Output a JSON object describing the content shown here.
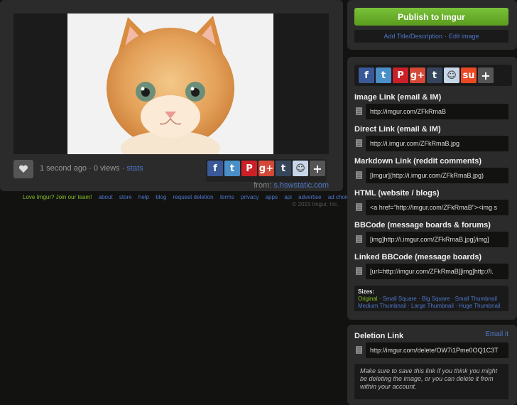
{
  "image": {
    "time_ago": "1 second ago",
    "views": "0 views",
    "stats_label": "stats",
    "from_label": "from:",
    "from_source": "s.hswstatic.com"
  },
  "footer": {
    "join": "Love Imgur? Join our team!",
    "links": [
      "about",
      "store",
      "help",
      "blog",
      "request deletion",
      "terms",
      "privacy",
      "apps",
      "api",
      "advertise",
      "ad choices"
    ],
    "copyright": "© 2015 Imgur, Inc."
  },
  "publish": {
    "button": "Publish to Imgur",
    "add_title": "Add Title/Description",
    "edit_image": "Edit image"
  },
  "links": [
    {
      "label": "Image Link (email & IM)",
      "value": "http://imgur.com/ZFkRmaB"
    },
    {
      "label": "Direct Link (email & IM)",
      "value": "http://i.imgur.com/ZFkRmaB.jpg"
    },
    {
      "label": "Markdown Link (reddit comments)",
      "value": "[Imgur](http://i.imgur.com/ZFkRmaB.jpg)"
    },
    {
      "label": "HTML (website / blogs)",
      "value": "<a href=\"http://imgur.com/ZFkRmaB\"><img s"
    },
    {
      "label": "BBCode (message boards & forums)",
      "value": "[img]http://i.imgur.com/ZFkRmaB.jpg[/img]"
    },
    {
      "label": "Linked BBCode (message boards)",
      "value": "[url=http://imgur.com/ZFkRmaB][img]http://i."
    }
  ],
  "sizes": {
    "title": "Sizes:",
    "original": "Original",
    "items": [
      "Small Square",
      "Big Square",
      "Small Thumbnail",
      "Medium Thumbnail",
      "Large Thumbnail",
      "Huge Thumbnail"
    ]
  },
  "deletion": {
    "label": "Deletion Link",
    "email_it": "Email it",
    "value": "http://imgur.com/delete/OW7i1Pme0OQ1C3T",
    "note": "Make sure to save this link if you think you might be deleting the image, or you can delete it from within your account."
  },
  "colors": {
    "accent_blue": "#4e76c9",
    "accent_green": "#85bf25",
    "panel": "#2b2b2b",
    "background": "#121211"
  },
  "icons": {
    "share": [
      "facebook-icon",
      "twitter-icon",
      "pinterest-icon",
      "google-plus-icon",
      "tumblr-icon",
      "reddit-icon",
      "stumbleupon-icon",
      "more-plus-icon"
    ]
  }
}
